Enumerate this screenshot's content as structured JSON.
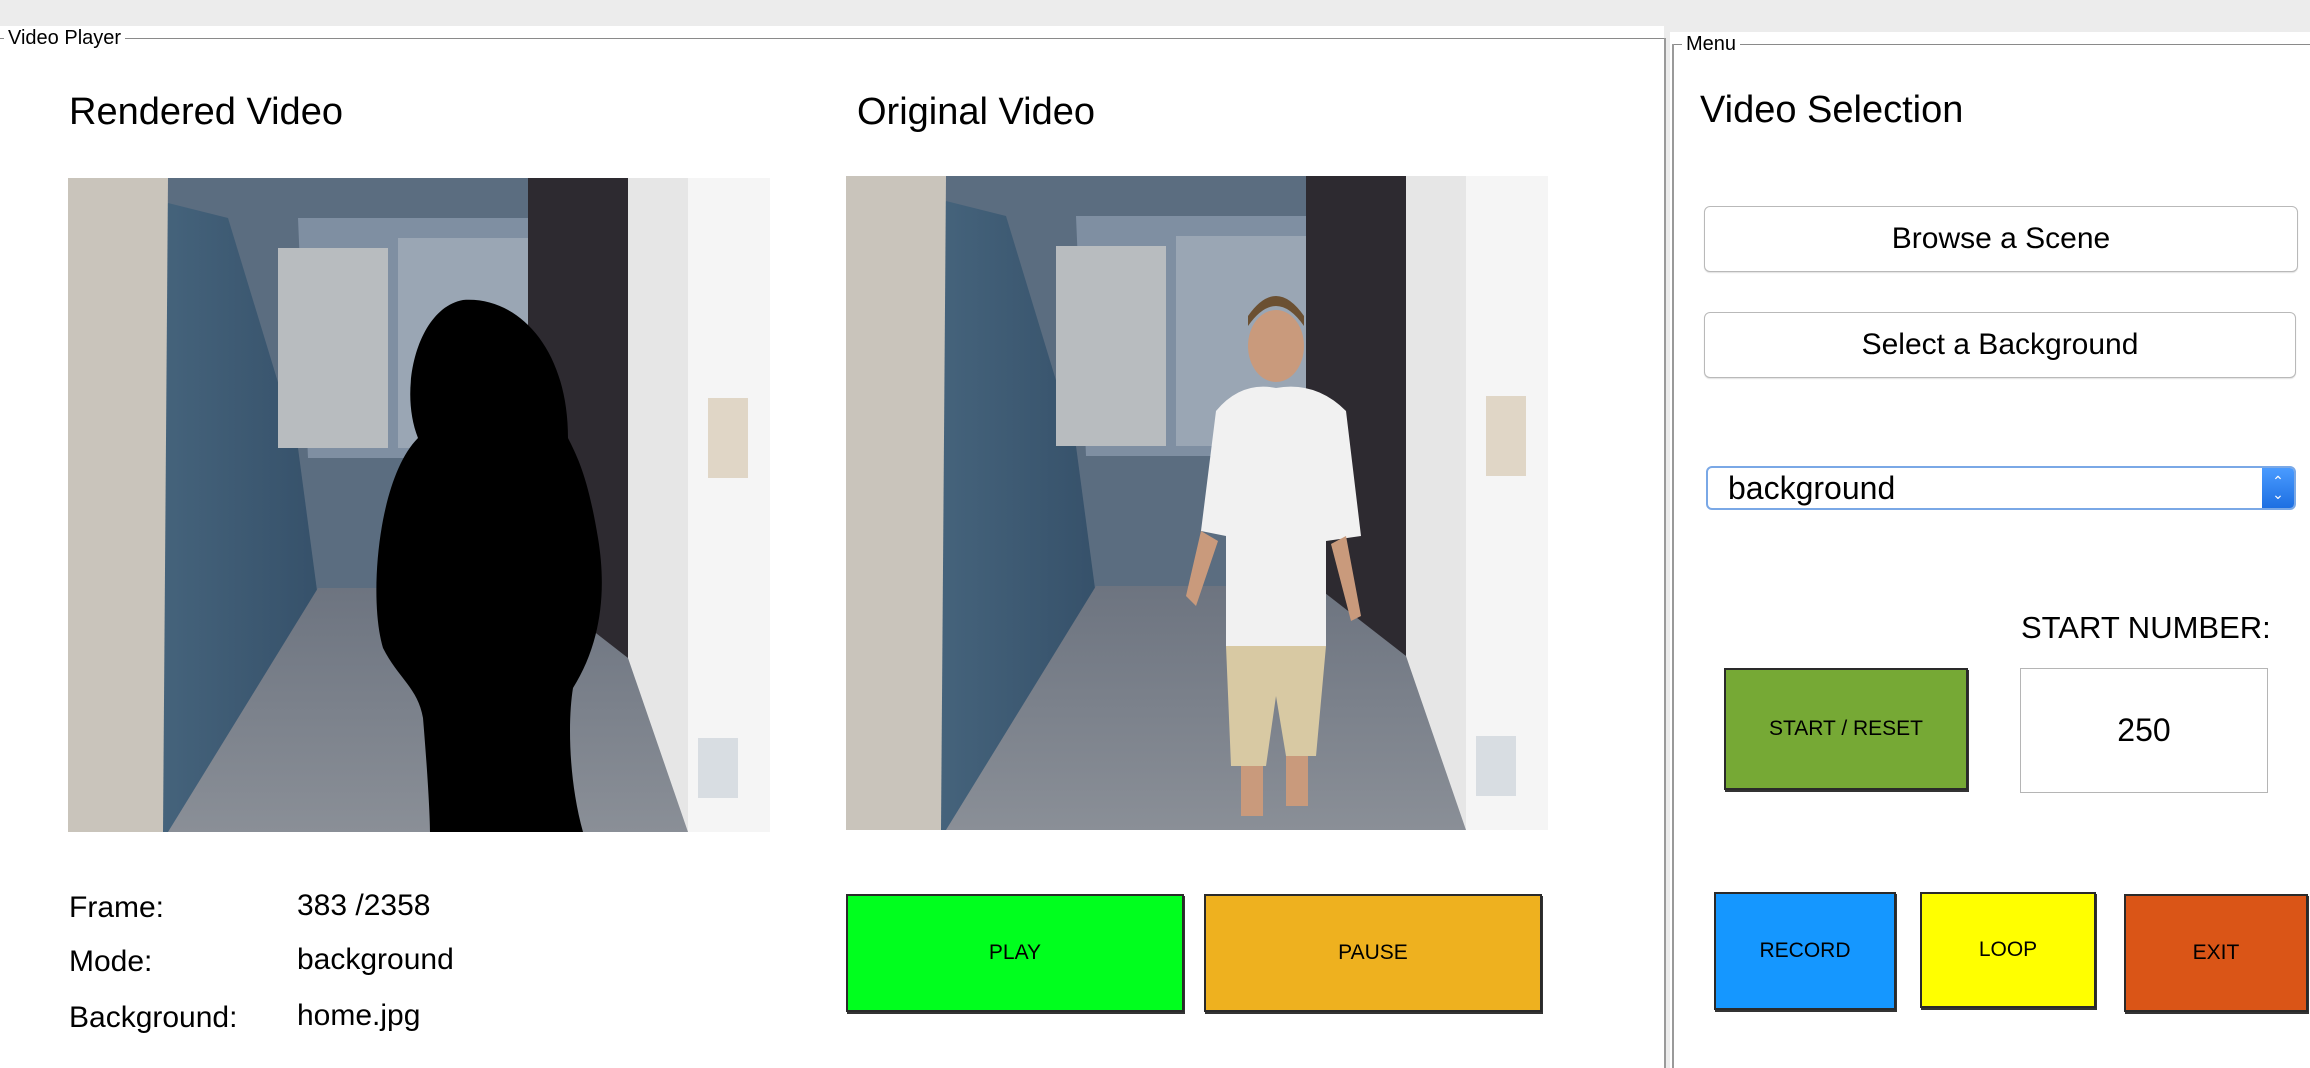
{
  "video_player": {
    "group_title": "Video Player",
    "rendered_title": "Rendered Video",
    "original_title": "Original Video",
    "info": {
      "frame_label": "Frame:",
      "frame_value": "383 /2358",
      "mode_label": "Mode:",
      "mode_value": "background",
      "background_label": "Background:",
      "background_value": "home.jpg"
    },
    "play_label": "PLAY",
    "pause_label": "PAUSE"
  },
  "menu": {
    "group_title": "Menu",
    "title": "Video Selection",
    "browse_label": "Browse a Scene",
    "select_background_label": "Select a Background",
    "dropdown_value": "background",
    "start_number_label": "START NUMBER:",
    "start_number_value": "250",
    "start_reset_label": "START / RESET",
    "record_label": "RECORD",
    "loop_label": "LOOP",
    "exit_label": "EXIT"
  },
  "colors": {
    "play": "#00ff1e",
    "pause": "#eeb11f",
    "start_reset": "#76a935",
    "record": "#1597ff",
    "loop": "#ffff00",
    "exit": "#da5517"
  }
}
